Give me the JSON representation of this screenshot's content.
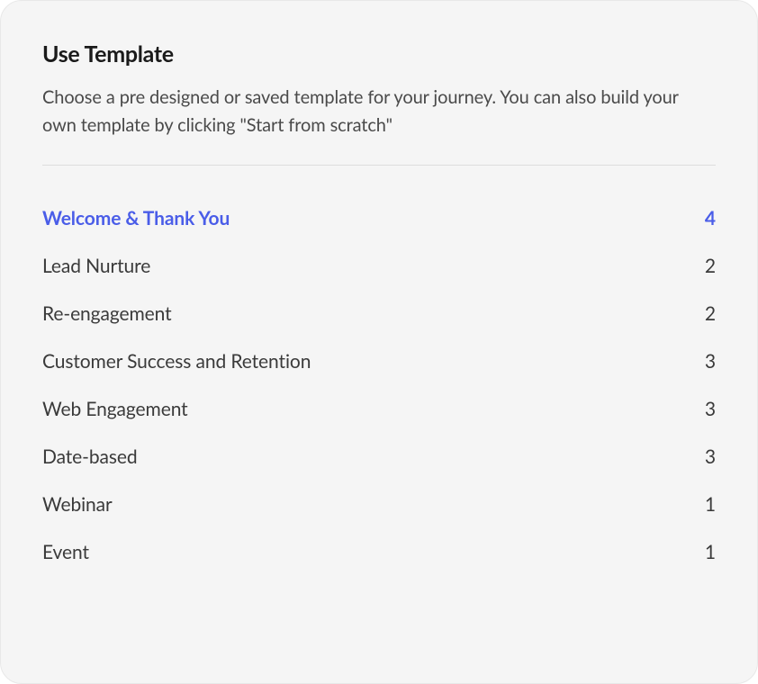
{
  "header": {
    "title": "Use Template",
    "description": "Choose a pre designed or saved template for your journey. You can also build your own template by clicking \"Start from scratch\""
  },
  "categories": [
    {
      "label": "Welcome & Thank You",
      "count": "4",
      "active": true
    },
    {
      "label": "Lead Nurture",
      "count": "2",
      "active": false
    },
    {
      "label": "Re-engagement",
      "count": "2",
      "active": false
    },
    {
      "label": "Customer Success and Retention",
      "count": "3",
      "active": false
    },
    {
      "label": "Web Engagement",
      "count": "3",
      "active": false
    },
    {
      "label": "Date-based",
      "count": "3",
      "active": false
    },
    {
      "label": "Webinar",
      "count": "1",
      "active": false
    },
    {
      "label": "Event",
      "count": "1",
      "active": false
    }
  ]
}
